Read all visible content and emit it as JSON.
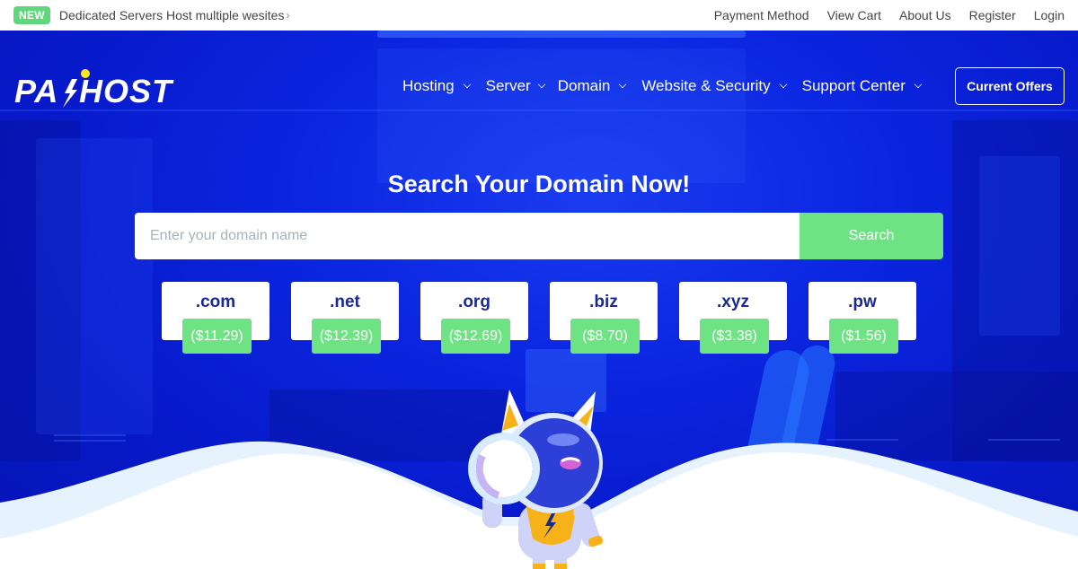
{
  "topbar": {
    "badge": "NEW",
    "announcement": "Dedicated Servers Host multiple wesites",
    "announcement_icon": "chevron-right-icon",
    "links": [
      "Payment Method",
      "View Cart",
      "About Us",
      "Register",
      "Login"
    ]
  },
  "nav": {
    "logo_text": "PAHOST",
    "menu": [
      {
        "label": "Hosting",
        "icon": "chevron-down-icon"
      },
      {
        "label": "Server",
        "icon": "chevron-down-icon"
      },
      {
        "label": "Domain",
        "icon": "chevron-down-icon"
      },
      {
        "label": "Website & Security",
        "icon": "chevron-down-icon"
      },
      {
        "label": "Support Center",
        "icon": "chevron-down-icon"
      }
    ],
    "cta": "Current Offers"
  },
  "hero": {
    "title": "Search Your Domain Now!",
    "search_placeholder": "Enter your domain name",
    "search_value": "",
    "search_button": "Search",
    "tlds": [
      {
        "ext": ".com",
        "price": "($11.29)"
      },
      {
        "ext": ".net",
        "price": "($12.39)"
      },
      {
        "ext": ".org",
        "price": "($12.69)"
      },
      {
        "ext": ".biz",
        "price": "($8.70)"
      },
      {
        "ext": ".xyz",
        "price": "($3.38)"
      },
      {
        "ext": ".pw",
        "price": "($1.56)"
      }
    ]
  },
  "colors": {
    "brand_blue": "#0b25e0",
    "accent_green": "#6ee384",
    "tld_text": "#1b2a8f",
    "logo_dot": "#ffe81a"
  }
}
